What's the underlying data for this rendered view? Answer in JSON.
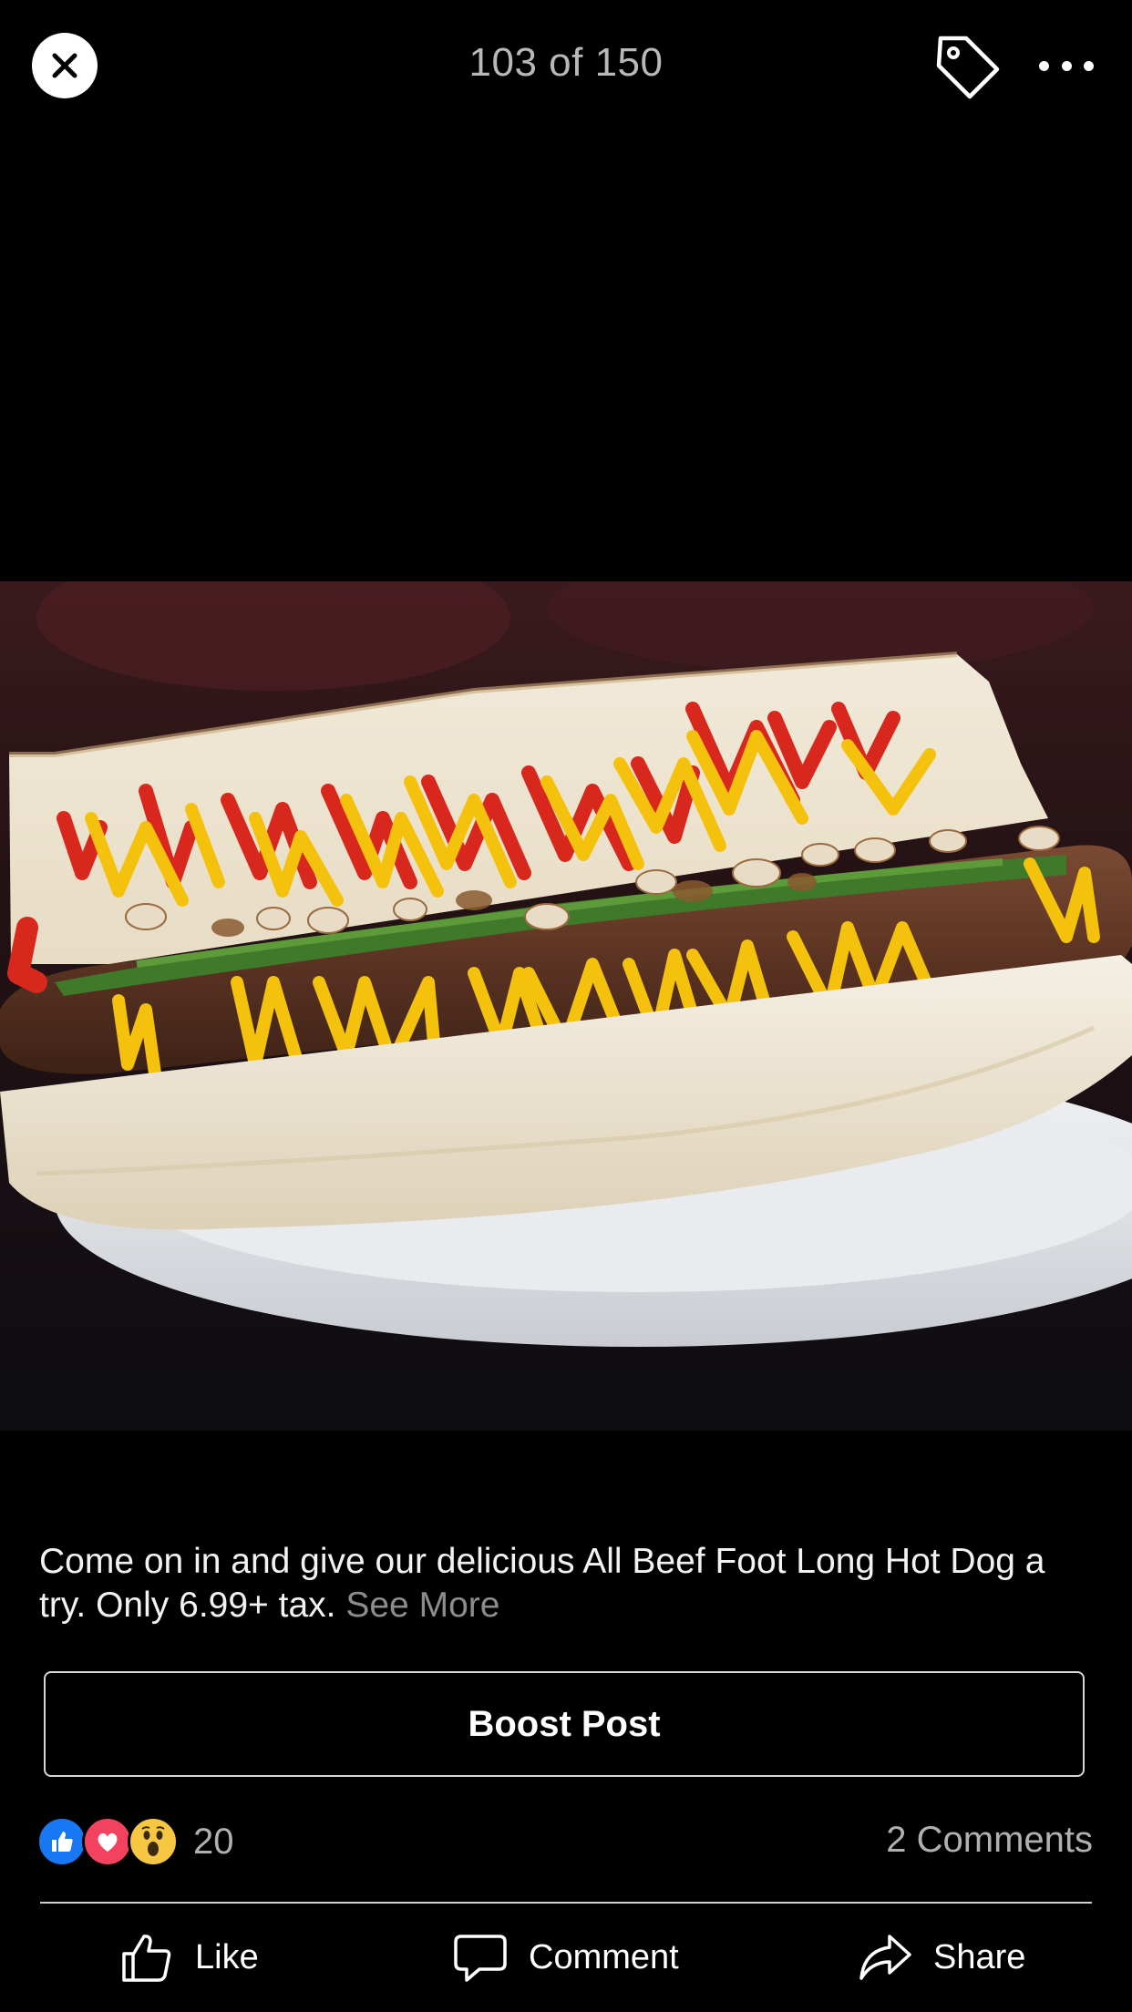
{
  "viewer": {
    "counter": "103 of 150"
  },
  "post": {
    "caption": "Come on in and give our delicious All Beef Foot Long Hot Dog a try. Only 6.99+ tax.",
    "see_more_label": "See More",
    "boost_label": "Boost Post",
    "reaction_count": "20",
    "comments_label": "2 Comments"
  },
  "actions": {
    "like_label": "Like",
    "comment_label": "Comment",
    "share_label": "Share"
  },
  "icons": {
    "close": "close-icon",
    "tag": "tag-icon",
    "more": "more-icon",
    "like_reaction": "thumbs-up-icon",
    "love_reaction": "heart-icon",
    "wow_reaction": "wow-face-icon",
    "like_action": "thumbs-up-outline-icon",
    "comment_action": "speech-bubble-icon",
    "share_action": "share-arrow-icon"
  },
  "colors": {
    "background": "#000000",
    "like_blue": "#1877f2",
    "love_red": "#f3425f",
    "wow_yellow": "#f7c744",
    "muted_text": "#8c8c8c"
  }
}
